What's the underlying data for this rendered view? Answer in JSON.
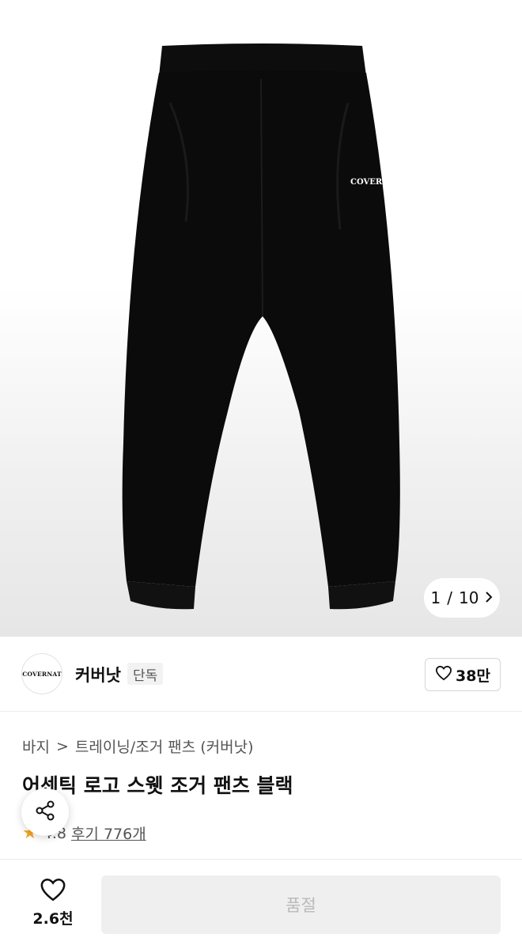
{
  "product_image": {
    "pager_current": "1",
    "pager_separator": "/",
    "pager_total": "10",
    "garment_logo_text": "COVERNAT"
  },
  "brand": {
    "logo_text": "COVERNAT",
    "name": "커버낫",
    "badge": "단독",
    "like_count": "38만"
  },
  "breadcrumb": {
    "category": "바지",
    "separator": ">",
    "subcategory": "트레이닝/조거 팬츠 (커버낫)"
  },
  "product": {
    "title": "어센틱 로고 스웻 조거 팬츠 블랙",
    "rating": "4.8",
    "reviews_label": "후기 776개"
  },
  "bottom_bar": {
    "wish_count": "2.6천",
    "buy_button_label": "품절"
  },
  "colors": {
    "accent_star": "#f5a623",
    "garment": "#0b0b0b",
    "disabled_button_bg": "#efefef",
    "disabled_button_text": "#b9b9b9"
  },
  "icons": [
    "heart-icon",
    "share-icon",
    "star-icon",
    "chevron-right-icon"
  ]
}
